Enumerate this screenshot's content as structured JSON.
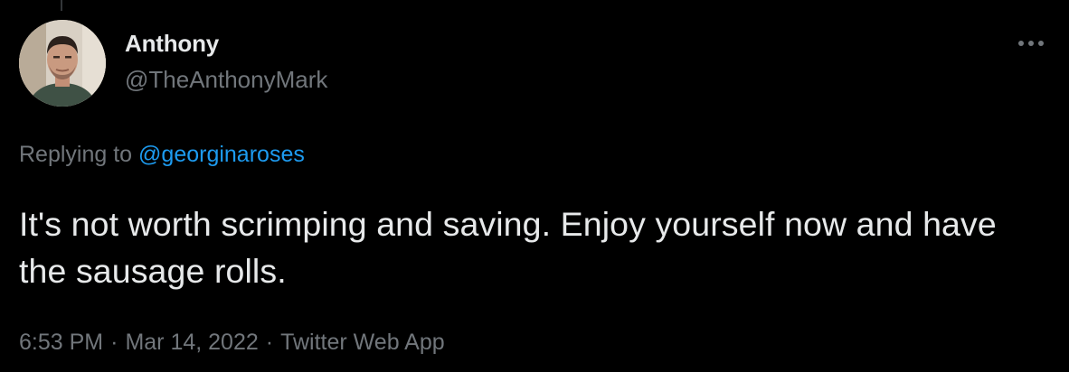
{
  "author": {
    "display_name": "Anthony",
    "handle": "@TheAnthonyMark",
    "avatar_icon": "profile-photo-avatar"
  },
  "reply": {
    "prefix": "Replying to",
    "target_handle": "@georginaroses"
  },
  "tweet": {
    "text": "It's not worth scrimping and saving. Enjoy yourself now and have the sausage rolls."
  },
  "meta": {
    "time": "6:53 PM",
    "separator": "·",
    "date": "Mar 14, 2022",
    "source": "Twitter Web App"
  },
  "icons": {
    "more": "more-options-icon"
  },
  "colors": {
    "background": "#000000",
    "text_primary": "#e7e9ea",
    "text_secondary": "#71767b",
    "link": "#1d9bf0"
  }
}
